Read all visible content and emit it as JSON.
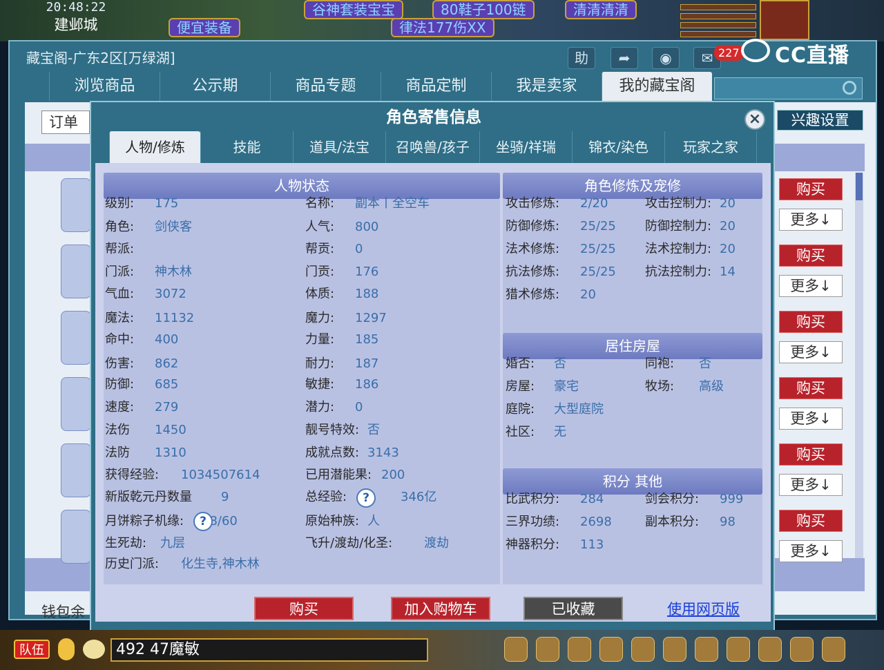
{
  "game": {
    "time": "20:48:22",
    "city": "建邺城",
    "tags": [
      "谷神套装宝宝",
      "80鞋子100链",
      "清清清清",
      "便宜装备",
      "律法177伤XX"
    ]
  },
  "stream": {
    "brand": "CC直播",
    "badge": "227"
  },
  "window": {
    "title": "藏宝阁-广东2区[万绿湖]",
    "help": "助",
    "nav": [
      "浏览商品",
      "公示期",
      "商品专题",
      "商品定制",
      "我是卖家",
      "我的藏宝阁"
    ],
    "order": "订单",
    "interest": "兴趣设置",
    "wallet": "钱包余"
  },
  "side": {
    "buy": "购买",
    "more": "更多↓"
  },
  "modal": {
    "title": "角色寄售信息",
    "close": "×",
    "tabs": [
      "人物/修炼",
      "技能",
      "道具/法宝",
      "召唤兽/孩子",
      "坐骑/祥瑞",
      "锦衣/染色",
      "玩家之家"
    ],
    "status": {
      "header": "人物状态",
      "left": [
        {
          "k": "级别:",
          "v": "175"
        },
        {
          "k": "角色:",
          "v": "剑侠客"
        },
        {
          "k": "帮派:",
          "v": ""
        },
        {
          "k": "门派:",
          "v": "神木林"
        },
        {
          "k": "气血:",
          "v": "3072"
        },
        {
          "k": "魔法:",
          "v": "11132"
        },
        {
          "k": "命中:",
          "v": "400"
        },
        {
          "k": "伤害:",
          "v": "862"
        },
        {
          "k": "防御:",
          "v": "685"
        },
        {
          "k": "速度:",
          "v": "279"
        },
        {
          "k": "法伤",
          "v": "1450"
        },
        {
          "k": "法防",
          "v": "1310"
        },
        {
          "k": "获得经验:",
          "v": "1034507614"
        },
        {
          "k": "新版乾元丹数量",
          "v": "9"
        },
        {
          "k": "月饼粽子机缘:",
          "v": "28/60"
        },
        {
          "k": "生死劫:",
          "v": "九层"
        },
        {
          "k": "历史门派:",
          "v": "化生寺,神木林"
        }
      ],
      "right": [
        {
          "k": "名称:",
          "v": "副本丨全空车"
        },
        {
          "k": "人气:",
          "v": "800"
        },
        {
          "k": "帮贡:",
          "v": "0"
        },
        {
          "k": "门贡:",
          "v": "176"
        },
        {
          "k": "体质:",
          "v": "188"
        },
        {
          "k": "魔力:",
          "v": "1297"
        },
        {
          "k": "力量:",
          "v": "185"
        },
        {
          "k": "耐力:",
          "v": "187"
        },
        {
          "k": "敏捷:",
          "v": "186"
        },
        {
          "k": "潜力:",
          "v": "0"
        },
        {
          "k": "靓号特效:",
          "v": "否"
        },
        {
          "k": "成就点数:",
          "v": "3143"
        },
        {
          "k": "已用潜能果:",
          "v": "200"
        },
        {
          "k": "总经验:",
          "v": "346亿"
        },
        {
          "k": "原始种族:",
          "v": "人"
        },
        {
          "k": "飞升/渡劫/化圣:",
          "v": "渡劫"
        }
      ],
      "help": "?"
    },
    "cult": {
      "header": "角色修炼及宠修",
      "rows": [
        {
          "k1": "攻击修炼:",
          "v1": "2/20",
          "k2": "攻击控制力:",
          "v2": "20"
        },
        {
          "k1": "防御修炼:",
          "v1": "25/25",
          "k2": "防御控制力:",
          "v2": "20"
        },
        {
          "k1": "法术修炼:",
          "v1": "25/25",
          "k2": "法术控制力:",
          "v2": "20"
        },
        {
          "k1": "抗法修炼:",
          "v1": "25/25",
          "k2": "抗法控制力:",
          "v2": "14"
        },
        {
          "k1": "猎术修炼:",
          "v1": "20",
          "k2": "",
          "v2": ""
        }
      ]
    },
    "house": {
      "header": "居住房屋",
      "rows": [
        {
          "k1": "婚否:",
          "v1": "否",
          "k2": "同袍:",
          "v2": "否"
        },
        {
          "k1": "房屋:",
          "v1": "豪宅",
          "k2": "牧场:",
          "v2": "高级"
        },
        {
          "k1": "庭院:",
          "v1": "大型庭院",
          "k2": "",
          "v2": ""
        },
        {
          "k1": "社区:",
          "v1": "无",
          "k2": "",
          "v2": ""
        }
      ]
    },
    "score": {
      "header": "积分 其他",
      "rows": [
        {
          "k1": "比武积分:",
          "v1": "284",
          "k2": "剑会积分:",
          "v2": "999"
        },
        {
          "k1": "三界功绩:",
          "v1": "2698",
          "k2": "副本积分:",
          "v2": "98"
        },
        {
          "k1": "神器积分:",
          "v1": "113",
          "k2": "",
          "v2": ""
        }
      ]
    },
    "buttons": {
      "buy": "购买",
      "cart": "加入购物车",
      "saved": "已收藏",
      "web": "使用网页版"
    }
  },
  "bottom": {
    "team": "队伍",
    "chat": "492 47魔敏"
  }
}
